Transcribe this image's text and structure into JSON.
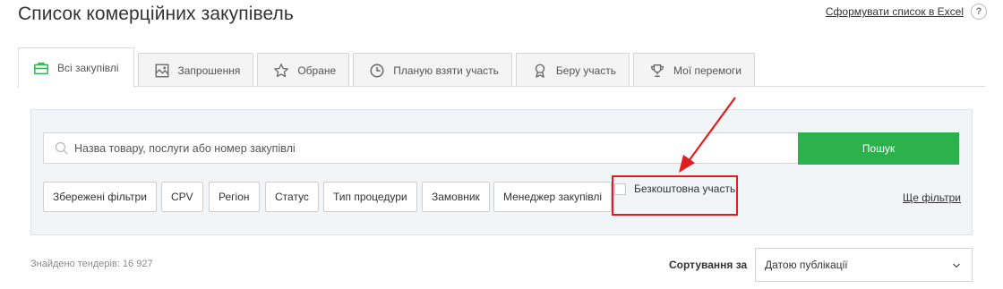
{
  "header": {
    "title": "Список комерційних закупівель",
    "excel_link": "Сформувати список в Excel",
    "help": "?"
  },
  "tabs": [
    {
      "label": "Всі закупівлі",
      "icon": "briefcase-icon",
      "active": true
    },
    {
      "label": "Запрошення",
      "icon": "invitation-icon",
      "active": false
    },
    {
      "label": "Обране",
      "icon": "star-icon",
      "active": false
    },
    {
      "label": "Планую взяти участь",
      "icon": "clock-icon",
      "active": false
    },
    {
      "label": "Беру участь",
      "icon": "ribbon-icon",
      "active": false
    },
    {
      "label": "Мої перемоги",
      "icon": "trophy-icon",
      "active": false
    }
  ],
  "search": {
    "placeholder": "Назва товару, послуги або номер закупівлі",
    "value": "",
    "button_label": "Пошук"
  },
  "filters": {
    "saved": "Збережені фільтри",
    "cpv": "CPV",
    "region": "Регіон",
    "status": "Статус",
    "procedure_type": "Тип процедури",
    "customer": "Замовник",
    "manager": "Менеджер закупівлі",
    "free_participation": "Безкоштовна участь",
    "free_participation_checked": false,
    "more": "Ще фільтри"
  },
  "results": {
    "found": "Знайдено тендерів: 16 927",
    "sort_label": "Сортування за",
    "sort_value": "Датою публікації"
  },
  "colors": {
    "accent_green": "#2bb24c",
    "highlight_red": "#e01e1e",
    "panel_bg": "#f2f5f8"
  }
}
